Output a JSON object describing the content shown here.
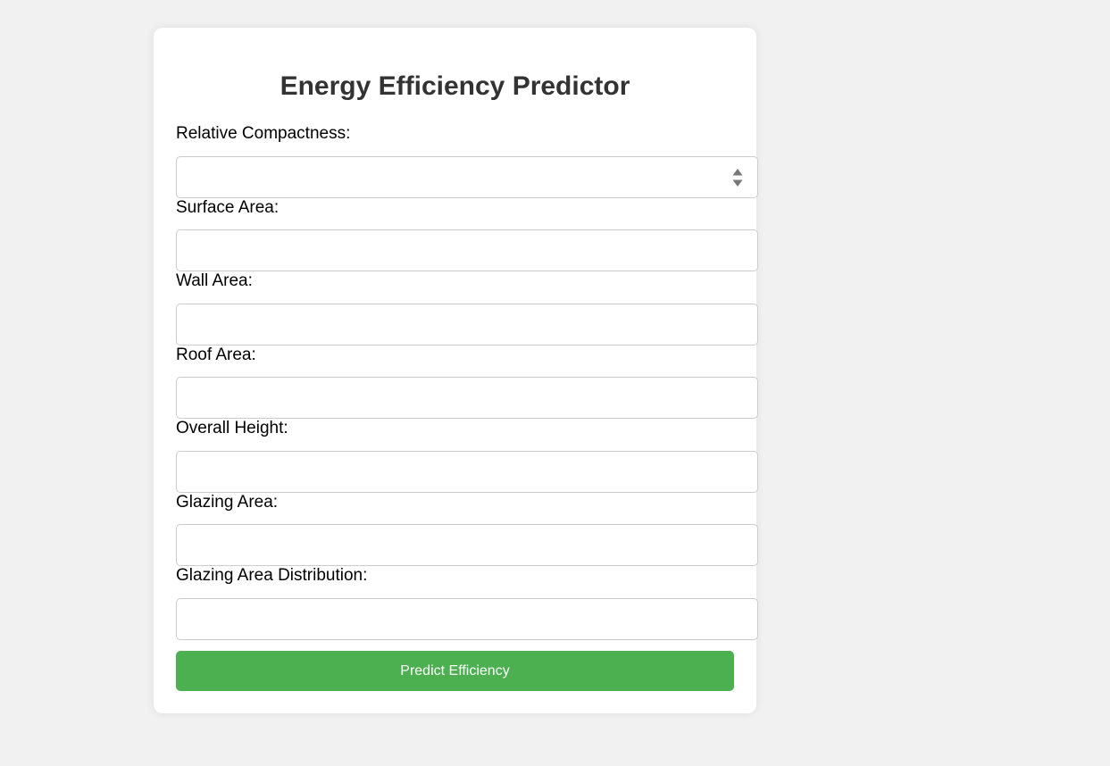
{
  "form": {
    "title": "Energy Efficiency Predictor",
    "fields": [
      {
        "label": "Relative Compactness:",
        "value": "",
        "type": "number"
      },
      {
        "label": "Surface Area:",
        "value": ""
      },
      {
        "label": "Wall Area:",
        "value": ""
      },
      {
        "label": "Roof Area:",
        "value": ""
      },
      {
        "label": "Overall Height:",
        "value": ""
      },
      {
        "label": "Glazing Area:",
        "value": ""
      },
      {
        "label": "Glazing Area Distribution:",
        "value": ""
      }
    ],
    "submit_label": "Predict Efficiency"
  },
  "colors": {
    "background": "#f1f1f1",
    "card": "#ffffff",
    "button": "#4caf50",
    "title": "#333333"
  },
  "icons": {
    "spinner": "number-spinner-icon"
  }
}
